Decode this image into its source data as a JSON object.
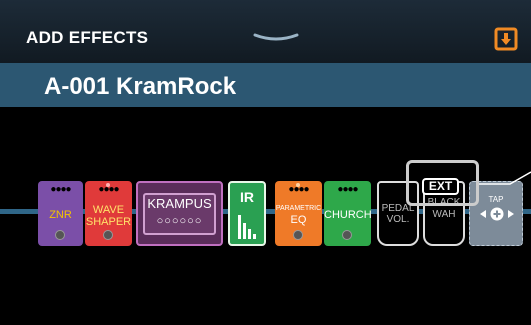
{
  "header": {
    "title": "ADD EFFECTS",
    "handle_icon": "chevron-down-icon",
    "export_icon": "export-icon",
    "accent_color": "#f08a24"
  },
  "patch": {
    "name": "A-001 KramRock"
  },
  "effects": [
    {
      "name": "ZNR",
      "color": "#7b4fa8"
    },
    {
      "name": "WAVE SHAPER",
      "line1": "WAVE",
      "line2": "SHAPER",
      "color": "#e03a3a"
    },
    {
      "name": "KRAMPUS",
      "color": "#5a2d5a"
    },
    {
      "name": "IR",
      "color": "#2aa052"
    },
    {
      "name": "PARAMETRIC EQ",
      "line1": "PARAMETRIC",
      "line2": "EQ",
      "color": "#ef7a28"
    },
    {
      "name": "CHURCH",
      "color": "#2ea84a"
    },
    {
      "name": "PEDAL VOL.",
      "line1": "PEDAL",
      "line2": "VOL.",
      "color": "#000000"
    },
    {
      "name": "BLACK WAH",
      "line1": "BLACK",
      "line2": "WAH",
      "color": "#000000"
    },
    {
      "name": "TAP",
      "color": "#7d8b99"
    }
  ],
  "ext_badge": "EXT",
  "tap_icon": "tap-arrows-icon"
}
